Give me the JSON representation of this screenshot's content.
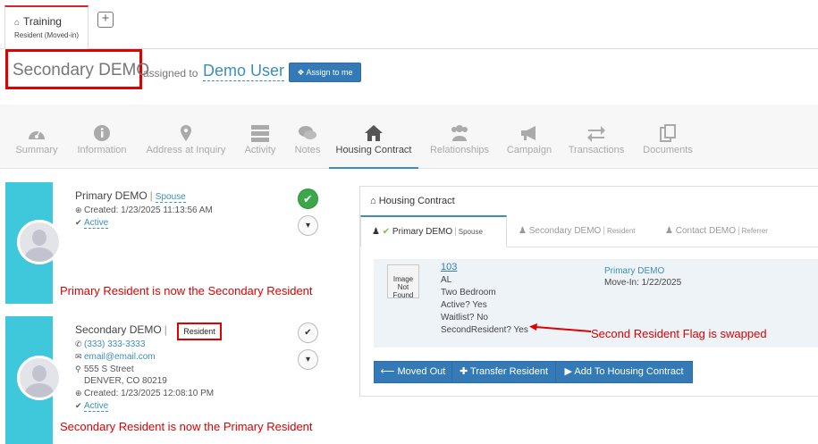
{
  "tab": {
    "title": "Training",
    "subtitle": "Resident (Moved-in)",
    "add_symbol": "+"
  },
  "header": {
    "name": "Secondary DEMO",
    "assigned_to_label": "assigned to",
    "assigned_user": "Demo User",
    "assign_button": "Assign to me"
  },
  "nav": {
    "items": [
      {
        "label": "Summary",
        "icon": "dashboard-icon"
      },
      {
        "label": "Information",
        "icon": "info-icon"
      },
      {
        "label": "Address at Inquiry",
        "icon": "map-marker-icon"
      },
      {
        "label": "Activity",
        "icon": "tasks-icon"
      },
      {
        "label": "Notes",
        "icon": "comments-icon"
      },
      {
        "label": "Housing Contract",
        "icon": "home-icon"
      },
      {
        "label": "Relationships",
        "icon": "users-icon"
      },
      {
        "label": "Campaign",
        "icon": "bullhorn-icon"
      },
      {
        "label": "Transactions",
        "icon": "exchange-icon"
      },
      {
        "label": "Documents",
        "icon": "files-icon"
      }
    ],
    "active": "Housing Contract"
  },
  "cards": [
    {
      "name": "Primary DEMO",
      "role": "Spouse",
      "created": "Created: 1/23/2025 11:13:56 AM",
      "status": "Active",
      "annotation": "Primary Resident is now the Secondary Resident"
    },
    {
      "name": "Secondary DEMO",
      "role": "Resident",
      "phone": "(333) 333-3333",
      "email": "email@email.com",
      "street": "555 S Street",
      "city": "DENVER, CO 80219",
      "created": "Created: 1/23/2025 12:08:10 PM",
      "status": "Active",
      "annotation": "Secondary Resident is now the Primary Resident"
    }
  ],
  "contract": {
    "title": "Housing Contract",
    "tabs": [
      {
        "name": "Primary DEMO",
        "role": "Spouse"
      },
      {
        "name": "Secondary DEMO",
        "role": "Resident"
      },
      {
        "name": "Contact DEMO",
        "role": "Referrer"
      }
    ],
    "unit": {
      "image_placeholder": "Image Not Found",
      "number": "103",
      "care_level": "AL",
      "type": "Two Bedroom",
      "active": "Active? Yes",
      "waitlist": "Waitlist? No",
      "second_resident": "SecondResident? Yes",
      "resident_name": "Primary DEMO",
      "move_in": "Move-In: 1/22/2025"
    },
    "annotation": "Second Resident Flag is swapped",
    "buttons": {
      "moved_out": "Moved Out",
      "transfer": "Transfer Resident",
      "add": "Add To Housing Contract"
    }
  },
  "colors": {
    "accent": "#3c8dbc",
    "button": "#337ab7",
    "card_bar": "#3fc8dc",
    "annotation": "#e00000",
    "tab_top": "#d9242a"
  }
}
